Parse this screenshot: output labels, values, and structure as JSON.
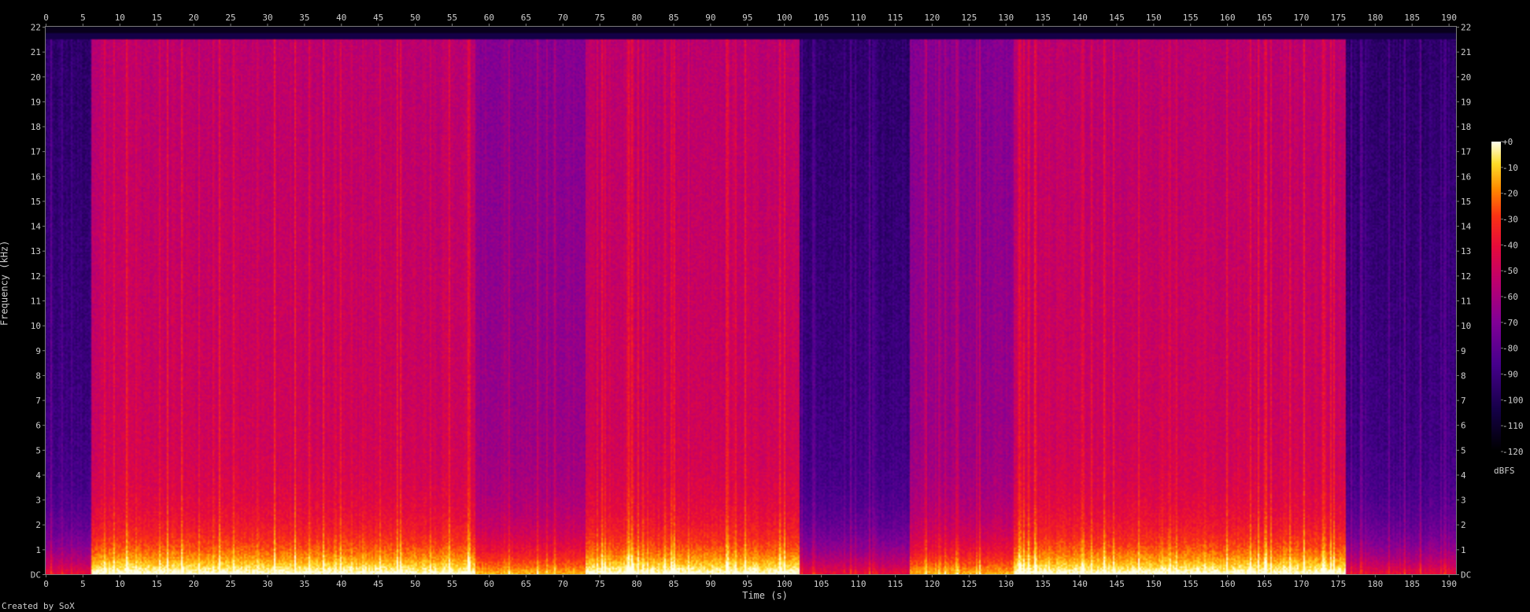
{
  "chart_data": {
    "type": "heatmap",
    "subtype": "spectrogram",
    "xlabel": "Time (s)",
    "ylabel": "Frequency (kHz)",
    "xlim": [
      0,
      191
    ],
    "ylim": [
      0,
      22
    ],
    "x_ticks": [
      0,
      5,
      10,
      15,
      20,
      25,
      30,
      35,
      40,
      45,
      50,
      55,
      60,
      65,
      70,
      75,
      80,
      85,
      90,
      95,
      100,
      105,
      110,
      115,
      120,
      125,
      130,
      135,
      140,
      145,
      150,
      155,
      160,
      165,
      170,
      175,
      180,
      185,
      190
    ],
    "x_tick_labels": [
      "0",
      "5",
      "10",
      "15",
      "20",
      "25",
      "30",
      "35",
      "40",
      "45",
      "50",
      "55",
      "60",
      "65",
      "70",
      "75",
      "80",
      "85",
      "90",
      "95",
      "100",
      "105",
      "110",
      "115",
      "120",
      "125",
      "130",
      "135",
      "140",
      "145",
      "150",
      "155",
      "160",
      "165",
      "170",
      "175",
      "180",
      "185",
      "190"
    ],
    "y_ticks": [
      0,
      1,
      2,
      3,
      4,
      5,
      6,
      7,
      8,
      9,
      10,
      11,
      12,
      13,
      14,
      15,
      16,
      17,
      18,
      19,
      20,
      21,
      22
    ],
    "y_tick_labels": [
      "DC",
      "1",
      "2",
      "3",
      "4",
      "5",
      "6",
      "7",
      "8",
      "9",
      "10",
      "11",
      "12",
      "13",
      "14",
      "15",
      "16",
      "17",
      "18",
      "19",
      "20",
      "21",
      "22"
    ],
    "colorbar": {
      "unit": "dBFS",
      "range": [
        -120,
        0
      ],
      "ticks": [
        0,
        -10,
        -20,
        -30,
        -40,
        -50,
        -60,
        -70,
        -80,
        -90,
        -100,
        -110,
        -120
      ],
      "tick_labels": [
        "+0",
        "-10",
        "-20",
        "-30",
        "-40",
        "-50",
        "-60",
        "-70",
        "-80",
        "-90",
        "-100",
        "-110",
        "-120"
      ]
    },
    "grid": false,
    "segments": [
      {
        "start": 0,
        "end": 6,
        "level": "quiet"
      },
      {
        "start": 6,
        "end": 42,
        "level": "loud"
      },
      {
        "start": 42,
        "end": 58,
        "level": "loud"
      },
      {
        "start": 58,
        "end": 73,
        "level": "medium"
      },
      {
        "start": 73,
        "end": 86,
        "level": "loud"
      },
      {
        "start": 86,
        "end": 102,
        "level": "loud"
      },
      {
        "start": 102,
        "end": 117,
        "level": "quiet"
      },
      {
        "start": 117,
        "end": 131,
        "level": "medium"
      },
      {
        "start": 131,
        "end": 176,
        "level": "loud"
      },
      {
        "start": 176,
        "end": 191,
        "level": "quiet"
      }
    ],
    "cutoff_khz": 21.5
  },
  "credit": "Created by SoX"
}
